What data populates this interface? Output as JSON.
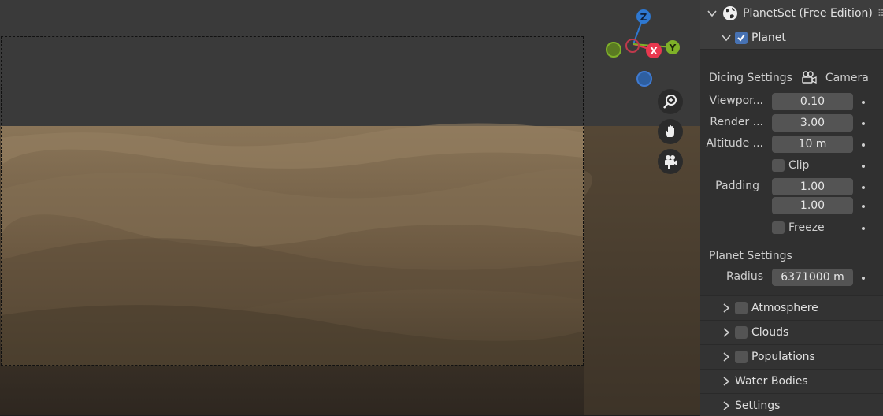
{
  "gizmo": {
    "z": "Z",
    "x": "X",
    "y": "Y"
  },
  "panel": {
    "title": "PlanetSet (Free Edition)",
    "planet_label": "Planet",
    "dicing_title": "Dicing Settings",
    "dicing_camera": "Camera",
    "fields": [
      {
        "label": "Viewpor...",
        "value": "0.10"
      },
      {
        "label": "Render ...",
        "value": "3.00"
      },
      {
        "label": "Altitude ...",
        "value": "10 m"
      }
    ],
    "clip_label": "Clip",
    "padding_label": "Padding",
    "padding_values": [
      "1.00",
      "1.00"
    ],
    "freeze_label": "Freeze",
    "planet_settings_title": "Planet Settings",
    "radius_label": "Radius",
    "radius_value": "6371000 m",
    "sections": [
      {
        "label": "Atmosphere",
        "checkbox": true
      },
      {
        "label": "Clouds",
        "checkbox": true
      },
      {
        "label": "Populations",
        "checkbox": true
      },
      {
        "label": "Water Bodies",
        "checkbox": false
      },
      {
        "label": "Settings",
        "checkbox": false
      }
    ]
  },
  "colors": {
    "x_axis": "#e8384f",
    "y_axis": "#7fb128",
    "z_axis": "#2e78d1",
    "accent_checkbox": "#4772b3",
    "sand": "#7a654a"
  }
}
